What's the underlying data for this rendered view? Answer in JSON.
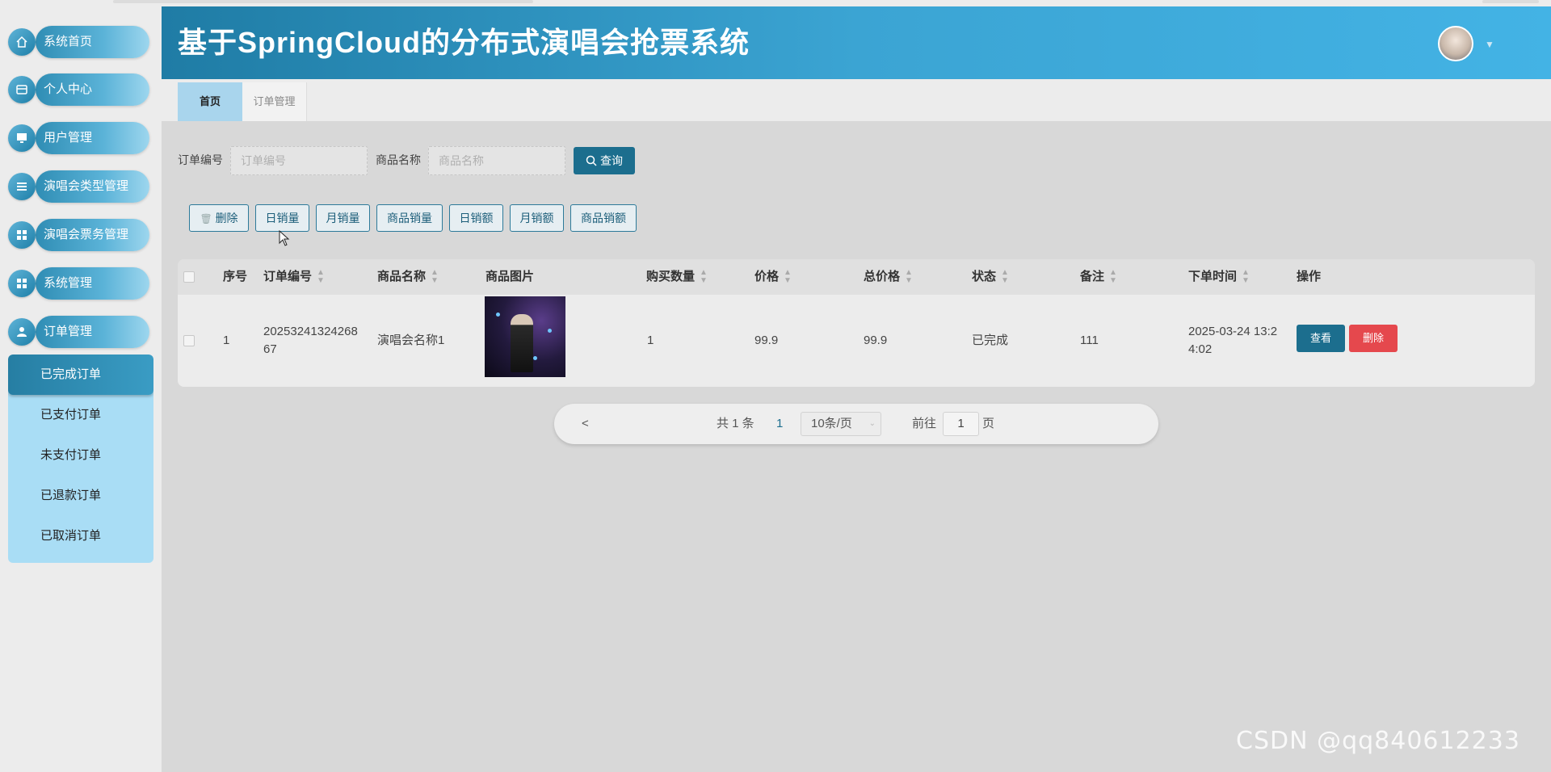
{
  "app": {
    "title": "基于SpringCloud的分布式演唱会抢票系统"
  },
  "colors": {
    "header_start": "#1f7ca5",
    "header_end": "#43b3e5",
    "primary_button": "#1c6e8e",
    "danger_button": "#e5484d",
    "submenu_bg": "#a9ddf5"
  },
  "sidebar": {
    "items": [
      {
        "label": "系统首页",
        "icon": "home-icon"
      },
      {
        "label": "个人中心",
        "icon": "card-icon"
      },
      {
        "label": "用户管理",
        "icon": "monitor-icon"
      },
      {
        "label": "演唱会类型管理",
        "icon": "list-icon"
      },
      {
        "label": "演唱会票务管理",
        "icon": "grid-icon"
      },
      {
        "label": "系统管理",
        "icon": "grid-icon"
      },
      {
        "label": "订单管理",
        "icon": "user-icon"
      }
    ],
    "submenu": [
      {
        "label": "已完成订单",
        "active": true
      },
      {
        "label": "已支付订单",
        "active": false
      },
      {
        "label": "未支付订单",
        "active": false
      },
      {
        "label": "已退款订单",
        "active": false
      },
      {
        "label": "已取消订单",
        "active": false
      }
    ]
  },
  "tabs": [
    {
      "label": "首页",
      "active": true
    },
    {
      "label": "订单管理",
      "active": false
    }
  ],
  "search": {
    "order_no_label": "订单编号",
    "order_no_placeholder": "订单编号",
    "product_name_label": "商品名称",
    "product_name_placeholder": "商品名称",
    "query_label": "查询"
  },
  "actions": {
    "delete": "删除",
    "daily_sales": "日销量",
    "monthly_sales": "月销量",
    "product_sales": "商品销量",
    "daily_revenue": "日销额",
    "monthly_revenue": "月销额",
    "product_revenue": "商品销额"
  },
  "table": {
    "columns": [
      "序号",
      "订单编号",
      "商品名称",
      "商品图片",
      "购买数量",
      "价格",
      "总价格",
      "状态",
      "备注",
      "下单时间",
      "操作"
    ],
    "rows": [
      {
        "index": "1",
        "order_no": "20253241324268 67",
        "product_name": "演唱会名称1",
        "quantity": "1",
        "price": "99.9",
        "total_price": "99.9",
        "status": "已完成",
        "remark": "111",
        "order_time": "2025-03-24 13:2 4:02",
        "view_label": "查看",
        "delete_label": "删除"
      }
    ]
  },
  "pagination": {
    "prev": "<",
    "total_text": "共 1 条",
    "current_page": "1",
    "page_size": "10条/页",
    "goto_label": "前往",
    "goto_value": "1",
    "goto_suffix": "页"
  },
  "watermark": "CSDN @qq840612233"
}
